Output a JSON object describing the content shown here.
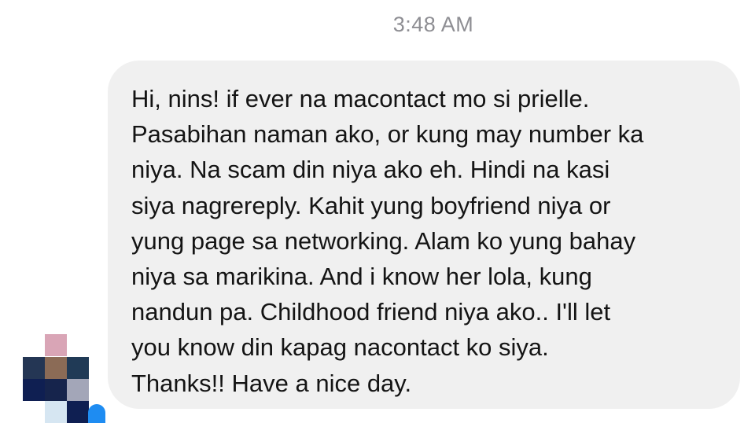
{
  "conversation": {
    "timestamp": "3:48 AM"
  },
  "message": {
    "lines": [
      "Hi, nins! if ever na macontact mo si prielle.",
      "Pasabihan naman ako, or kung may number ka",
      "niya. Na scam din niya ako eh. Hindi na kasi",
      "siya nagrereply. Kahit yung boyfriend niya or",
      "yung page sa networking. Alam ko yung bahay",
      "niya sa marikina. And i know her lola, kung",
      "nandun pa. Childhood friend niya ako.. I'll let",
      "you know din kapag nacontact ko siya.",
      "Thanks!! Have a nice day."
    ]
  },
  "sender": {
    "avatar": "pixelated-avatar",
    "avatar_colors": [
      "#d9a5b6",
      "#243654",
      "#8b6b56",
      "#203a56",
      "#0f1f52",
      "#16244c",
      "#a3a6b8",
      "#d6e6f2"
    ]
  },
  "receipt": {
    "icon": "read-receipt-icon",
    "color": "#1e8cf2"
  }
}
